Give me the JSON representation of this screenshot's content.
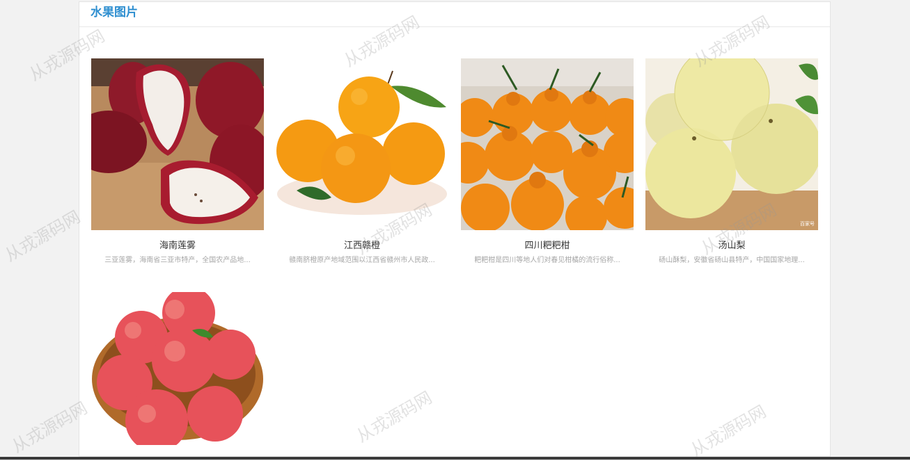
{
  "panel": {
    "title": "水果图片"
  },
  "cards": [
    {
      "title": "海南莲雾",
      "desc": "三亚莲雾，海南省三亚市特产，全国农产品地...",
      "image": "wax-apple"
    },
    {
      "title": "江西赣橙",
      "desc": "赣南脐橙原产地域范围以江西省赣州市人民政...",
      "image": "navel-orange"
    },
    {
      "title": "四川粑粑柑",
      "desc": "粑粑柑是四川等地人们对春见柑橘的流行俗称...",
      "image": "dekopon"
    },
    {
      "title": "汤山梨",
      "desc": "砀山酥梨，安徽省砀山县特产，中国国家地理...",
      "image": "pear"
    },
    {
      "title": "",
      "desc": "",
      "image": "apple-basket"
    }
  ],
  "watermark": "从戎源码网"
}
